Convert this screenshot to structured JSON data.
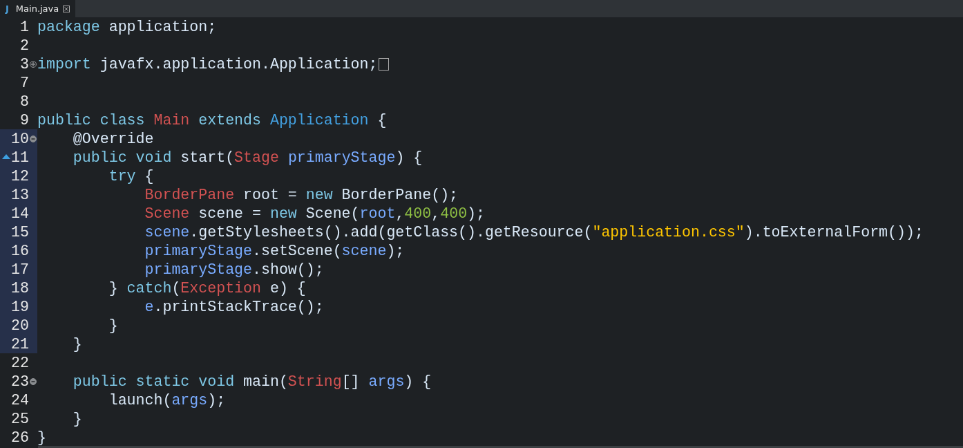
{
  "tab": {
    "icon_letter": "J",
    "title": "Main.java",
    "selected": true
  },
  "lines": [
    {
      "number": "1",
      "tokens": [
        {
          "kind": "keyword",
          "text": "package"
        },
        {
          "kind": "plain",
          "text": " application;"
        }
      ]
    },
    {
      "number": "2"
    },
    {
      "number": "3",
      "fold_open": false,
      "folded": true,
      "tokens": [
        {
          "kind": "keyword",
          "text": "import"
        },
        {
          "kind": "plain",
          "text": " javafx.application.Application;"
        }
      ]
    },
    {
      "number": "7"
    },
    {
      "number": "8"
    },
    {
      "number": "9",
      "tokens": [
        {
          "kind": "keyword",
          "text": "public class "
        },
        {
          "kind": "class",
          "text": "Main "
        },
        {
          "kind": "keyword",
          "text": "extends "
        },
        {
          "kind": "type",
          "text": "Application"
        },
        {
          "kind": "plain",
          "text": " {"
        }
      ]
    },
    {
      "number": "10",
      "fold_open": true,
      "in_range": true,
      "tokens": [
        {
          "kind": "plain",
          "text": "    @Override"
        }
      ]
    },
    {
      "number": "11",
      "in_range": true,
      "override": true,
      "tokens": [
        {
          "kind": "keyword",
          "text": "    public void"
        },
        {
          "kind": "plain",
          "text": " start("
        },
        {
          "kind": "class",
          "text": "Stage "
        },
        {
          "kind": "variable",
          "text": "primaryStage"
        },
        {
          "kind": "plain",
          "text": ") {"
        }
      ]
    },
    {
      "number": "12",
      "in_range": true,
      "tokens": [
        {
          "kind": "keyword",
          "text": "        try"
        },
        {
          "kind": "plain",
          "text": " {"
        }
      ]
    },
    {
      "number": "13",
      "in_range": true,
      "tokens": [
        {
          "kind": "class",
          "text": "            BorderPane"
        },
        {
          "kind": "plain",
          "text": " root = "
        },
        {
          "kind": "keyword",
          "text": "new"
        },
        {
          "kind": "plain",
          "text": " BorderPane();"
        }
      ]
    },
    {
      "number": "14",
      "in_range": true,
      "tokens": [
        {
          "kind": "class",
          "text": "            Scene"
        },
        {
          "kind": "plain",
          "text": " scene = "
        },
        {
          "kind": "keyword",
          "text": "new"
        },
        {
          "kind": "plain",
          "text": " Scene("
        },
        {
          "kind": "variable",
          "text": "root"
        },
        {
          "kind": "plain",
          "text": ","
        },
        {
          "kind": "number",
          "text": "400"
        },
        {
          "kind": "plain",
          "text": ","
        },
        {
          "kind": "number",
          "text": "400"
        },
        {
          "kind": "plain",
          "text": ");"
        }
      ]
    },
    {
      "number": "15",
      "in_range": true,
      "tokens": [
        {
          "kind": "variable",
          "text": "            scene"
        },
        {
          "kind": "plain",
          "text": ".getStylesheets().add(getClass().getResource("
        },
        {
          "kind": "string",
          "text": "\"application.css\""
        },
        {
          "kind": "plain",
          "text": ").toExternalForm());"
        }
      ]
    },
    {
      "number": "16",
      "in_range": true,
      "tokens": [
        {
          "kind": "variable",
          "text": "            primaryStage"
        },
        {
          "kind": "plain",
          "text": ".setScene("
        },
        {
          "kind": "variable",
          "text": "scene"
        },
        {
          "kind": "plain",
          "text": ");"
        }
      ]
    },
    {
      "number": "17",
      "in_range": true,
      "tokens": [
        {
          "kind": "variable",
          "text": "            primaryStage"
        },
        {
          "kind": "plain",
          "text": ".show();"
        }
      ]
    },
    {
      "number": "18",
      "in_range": true,
      "tokens": [
        {
          "kind": "plain",
          "text": "        } "
        },
        {
          "kind": "keyword",
          "text": "catch"
        },
        {
          "kind": "plain",
          "text": "("
        },
        {
          "kind": "class",
          "text": "Exception"
        },
        {
          "kind": "plain",
          "text": " e) {"
        }
      ]
    },
    {
      "number": "19",
      "in_range": true,
      "tokens": [
        {
          "kind": "variable",
          "text": "            e"
        },
        {
          "kind": "plain",
          "text": ".printStackTrace();"
        }
      ]
    },
    {
      "number": "20",
      "in_range": true,
      "tokens": [
        {
          "kind": "plain",
          "text": "        }"
        }
      ]
    },
    {
      "number": "21",
      "in_range": true,
      "tokens": [
        {
          "kind": "plain",
          "text": "    }"
        }
      ]
    },
    {
      "number": "22"
    },
    {
      "number": "23",
      "fold_open": true,
      "tokens": [
        {
          "kind": "keyword",
          "text": "    public static void"
        },
        {
          "kind": "plain",
          "text": " main("
        },
        {
          "kind": "class",
          "text": "String"
        },
        {
          "kind": "plain",
          "text": "[] "
        },
        {
          "kind": "variable",
          "text": "args"
        },
        {
          "kind": "plain",
          "text": ") {"
        }
      ]
    },
    {
      "number": "24",
      "tokens": [
        {
          "kind": "plain",
          "text": "        launch("
        },
        {
          "kind": "variable",
          "text": "args"
        },
        {
          "kind": "plain",
          "text": ");"
        }
      ]
    },
    {
      "number": "25",
      "tokens": [
        {
          "kind": "plain",
          "text": "    }"
        }
      ]
    },
    {
      "number": "26",
      "tokens": [
        {
          "kind": "plain",
          "text": "}"
        }
      ]
    }
  ]
}
